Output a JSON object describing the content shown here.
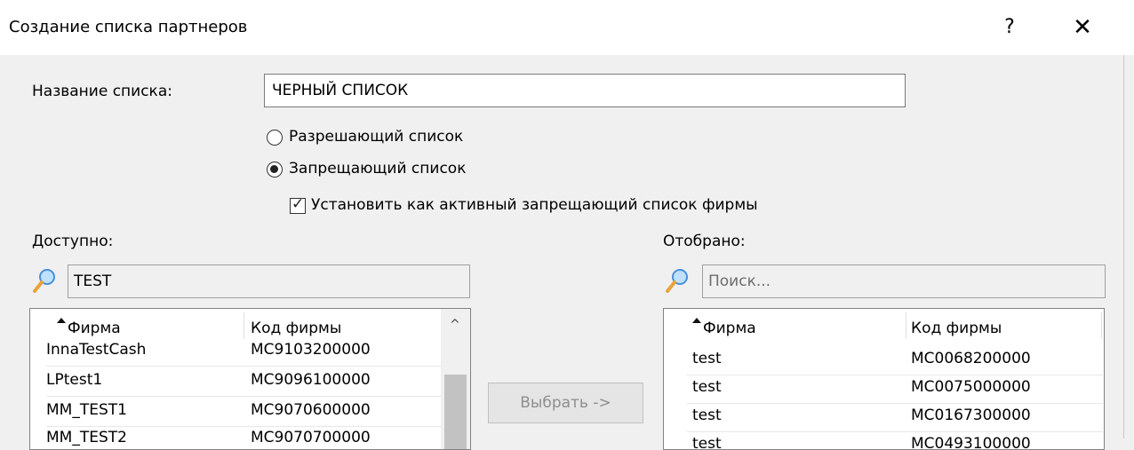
{
  "window": {
    "title": "Создание списка партнеров",
    "help_label": "?",
    "close_label": "✕"
  },
  "form": {
    "name_label": "Название списка:",
    "name_value": "ЧЕРНЫЙ СПИСОК",
    "radio_allow": "Разрешающий список",
    "radio_deny": "Запрещающий список",
    "selected_radio": "deny",
    "checkbox_label": "Установить как активный запрещающий список фирмы",
    "checkbox_checked": true
  },
  "available": {
    "label": "Доступно:",
    "search_value": "TEST",
    "columns": [
      "Фирма",
      "Код фирмы"
    ],
    "rows": [
      [
        "InnaTestCash",
        "MC9103200000"
      ],
      [
        "LPtest1",
        "MC9096100000"
      ],
      [
        "MM_TEST1",
        "MC9070600000"
      ],
      [
        "MM_TEST2",
        "MC9070700000"
      ]
    ]
  },
  "selected": {
    "label": "Отобрано:",
    "search_placeholder": "Поиск...",
    "columns": [
      "Фирма",
      "Код фирмы"
    ],
    "rows": [
      [
        "test",
        "MC0068200000"
      ],
      [
        "test",
        "MC0075000000"
      ],
      [
        "test",
        "MC0167300000"
      ],
      [
        "test",
        "MC0493100000"
      ]
    ]
  },
  "select_button": "Выбрать ->",
  "colors": {
    "accent_icon": "#f5a623",
    "lens": "#6fb3e8"
  }
}
